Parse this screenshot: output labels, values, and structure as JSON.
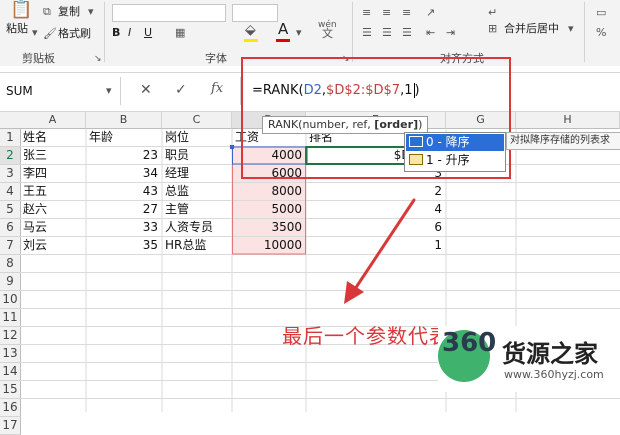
{
  "ribbon": {
    "paste": "粘贴",
    "copy": "复制",
    "format_painter": "格式刷",
    "clipboard_group": "剪贴板",
    "font_group": "字体",
    "font_color_letter": "A",
    "phonetic": "wén",
    "alignment_group": "对齐方式",
    "merge_center": "合并后居中"
  },
  "formula_bar": {
    "name_box": "SUM",
    "fx_label": "fx",
    "formula_prefix": "=RANK(",
    "formula_arg1": "D2",
    "formula_sep1": ",",
    "formula_arg2": "$D$2:$D$7",
    "formula_sep2": ",",
    "formula_arg3": "1",
    "formula_suffix": ")"
  },
  "columns": [
    "A",
    "B",
    "C",
    "D",
    "E",
    "G",
    "H"
  ],
  "rows": [
    "1",
    "2",
    "3",
    "4",
    "5",
    "6",
    "7",
    "8",
    "9",
    "10",
    "11",
    "12",
    "13",
    "14",
    "15",
    "16",
    "17"
  ],
  "sheet": {
    "header": [
      "姓名",
      "年龄",
      "岗位",
      "工资",
      "排名"
    ],
    "data": [
      {
        "name": "张三",
        "age": "23",
        "post": "职员",
        "salary": "4000",
        "rank": "$D$7,1)"
      },
      {
        "name": "李四",
        "age": "34",
        "post": "经理",
        "salary": "6000",
        "rank": "3"
      },
      {
        "name": "王五",
        "age": "43",
        "post": "总监",
        "salary": "8000",
        "rank": "2"
      },
      {
        "name": "赵六",
        "age": "27",
        "post": "主管",
        "salary": "5000",
        "rank": "4"
      },
      {
        "name": "马云",
        "age": "33",
        "post": "人资专员",
        "salary": "3500",
        "rank": "6"
      },
      {
        "name": "刘云",
        "age": "35",
        "post": "HR总监",
        "salary": "10000",
        "rank": "1"
      }
    ]
  },
  "tooltip": {
    "prefix": "RANK(number, ref, ",
    "current": "[order]",
    "suffix": ")"
  },
  "autocomplete": {
    "items": [
      "0 - 降序",
      "1 - 升序"
    ],
    "description": "对拟降序存储的列表求"
  },
  "annotation": {
    "text": "最后一个参数代表升降序"
  },
  "watermark": {
    "brand": "360",
    "name": "货源之家",
    "url": "www.360hyzj.com"
  },
  "colors": {
    "accent": "#d9383a",
    "excel_green": "#217346",
    "highlight": "#fbe3e3",
    "selection": "#2a6fd6"
  }
}
